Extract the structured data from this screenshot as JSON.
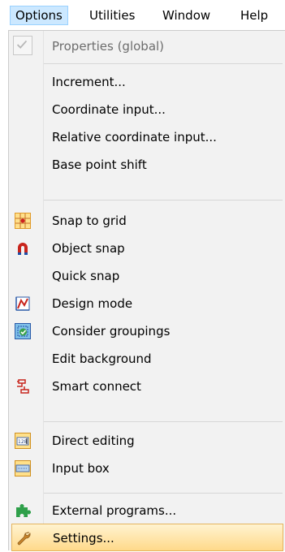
{
  "menubar": {
    "items": [
      {
        "label": "Options",
        "active": true
      },
      {
        "label": "Utilities"
      },
      {
        "label": "Window"
      },
      {
        "label": "Help"
      }
    ]
  },
  "menu": {
    "properties_global": "Properties (global)",
    "increment": "Increment...",
    "coordinate_input": "Coordinate input...",
    "relative_coordinate_input": "Relative coordinate input...",
    "base_point_shift": "Base point shift",
    "snap_to_grid": "Snap to grid",
    "object_snap": "Object snap",
    "quick_snap": "Quick snap",
    "design_mode": "Design mode",
    "consider_groupings": "Consider groupings",
    "edit_background": "Edit background",
    "smart_connect": "Smart connect",
    "direct_editing": "Direct editing",
    "input_box": "Input box",
    "external_programs": "External programs...",
    "settings": "Settings..."
  },
  "icons": {
    "properties_global": "checkmark-icon",
    "snap_to_grid": "grid-icon",
    "object_snap": "magnet-icon",
    "design_mode": "chart-icon",
    "consider_groupings": "group-icon",
    "smart_connect": "connector-icon",
    "direct_editing": "number-field-icon",
    "input_box": "input-box-icon",
    "external_programs": "puzzle-icon",
    "settings": "wrench-icon"
  },
  "icon_badges": {
    "direct_editing": "128"
  },
  "colors": {
    "menu_background": "#f2f2f2",
    "highlight": "#ffd98a",
    "active_menubar": "#cce8ff",
    "disabled_text": "#6d6d6d"
  }
}
